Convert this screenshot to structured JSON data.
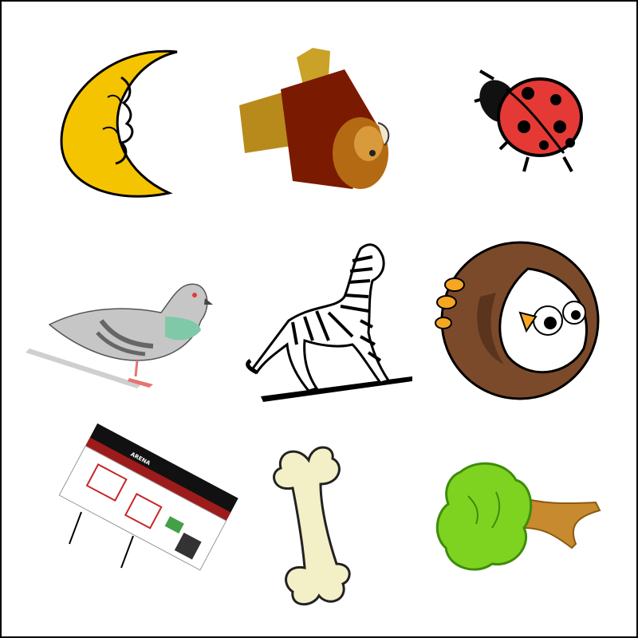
{
  "grid": {
    "rows": 3,
    "columns": 3,
    "items": [
      {
        "icon": "crescent-moon-face-icon",
        "color": "#f5c400"
      },
      {
        "icon": "lion-rotated-icon",
        "color": "#7a1a00"
      },
      {
        "icon": "ladybug-icon",
        "color": "#e53935"
      },
      {
        "icon": "pigeon-icon",
        "color": "#bdbdbd"
      },
      {
        "icon": "zebra-icon",
        "color": "#000000"
      },
      {
        "icon": "owl-icon",
        "color": "#7b4a2a"
      },
      {
        "icon": "arena-building-rotated-icon",
        "color": "#9e1b1b"
      },
      {
        "icon": "bone-icon",
        "color": "#f3efc7"
      },
      {
        "icon": "tree-rotated-icon",
        "color": "#7ed321"
      }
    ]
  },
  "sign": {
    "text": "ARENA"
  }
}
